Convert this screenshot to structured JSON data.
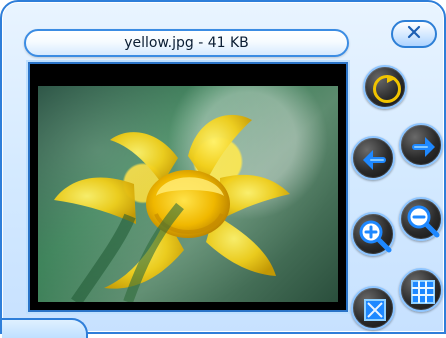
{
  "window": {
    "title": "yellow.jpg - 41 KB"
  },
  "icons": {
    "close": "close-icon",
    "rotate": "rotate-icon",
    "previous": "arrow-left-icon",
    "next": "arrow-right-icon",
    "zoom_in": "zoom-in-icon",
    "zoom_out": "zoom-out-icon",
    "fit": "fit-to-window-icon",
    "thumbnails": "thumbnails-grid-icon"
  },
  "colors": {
    "accent": "#2e7ed9",
    "window_bg": "#d3e9ff",
    "button_dark": "#2a2a2a",
    "arrow_blue": "#1e88ff"
  }
}
